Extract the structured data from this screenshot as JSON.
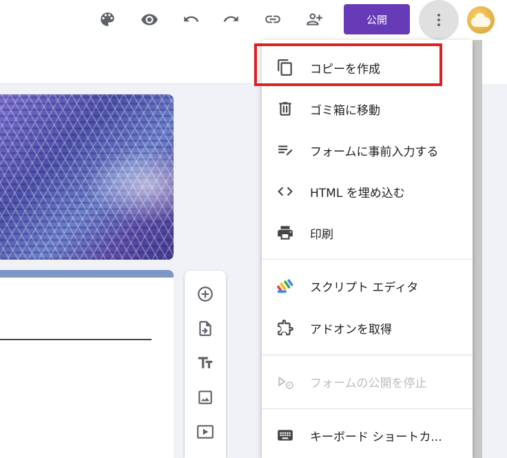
{
  "toolbar": {
    "publish_label": "公開",
    "icons": [
      "palette-icon",
      "eye-icon",
      "undo-icon",
      "redo-icon",
      "link-icon",
      "add-collaborator-icon",
      "more-vert-icon"
    ],
    "accent": "#673ab7"
  },
  "menu": {
    "items": [
      {
        "label": "コピーを作成",
        "icon": "copy-icon",
        "enabled": true,
        "highlighted": true
      },
      {
        "label": "ゴミ箱に移動",
        "icon": "trash-icon",
        "enabled": true
      },
      {
        "label": "フォームに事前入力する",
        "icon": "prefill-icon",
        "enabled": true
      },
      {
        "label": "HTML を埋め込む",
        "icon": "code-icon",
        "enabled": true
      },
      {
        "label": "印刷",
        "icon": "print-icon",
        "enabled": true
      },
      {
        "label": "スクリプト エディタ",
        "icon": "apps-script-icon",
        "enabled": true
      },
      {
        "label": "アドオンを取得",
        "icon": "puzzle-icon",
        "enabled": true
      },
      {
        "label": "フォームの公開を停止",
        "icon": "unpublish-icon",
        "enabled": false
      },
      {
        "label": "キーボード ショートカ...",
        "icon": "keyboard-icon",
        "enabled": true
      }
    ],
    "highlight_color": "#e02020"
  },
  "side_toolbar": {
    "icons": [
      "add-question-icon",
      "import-questions-icon",
      "add-title-icon",
      "add-image-icon",
      "add-video-icon"
    ]
  }
}
